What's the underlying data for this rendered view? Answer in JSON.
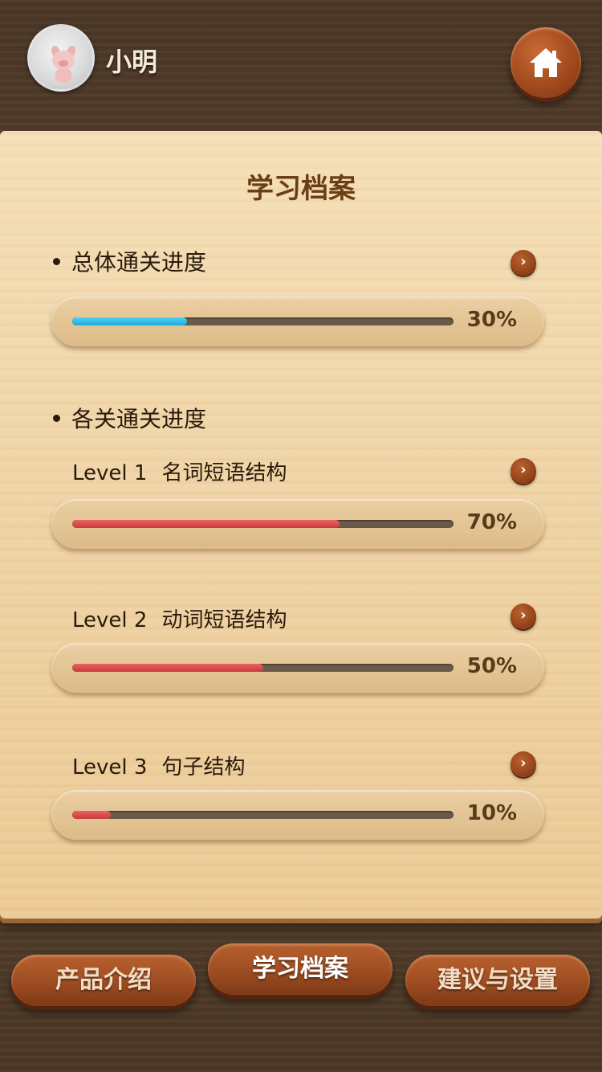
{
  "header": {
    "username": "小明",
    "avatar_icon": "pig-avatar-icon",
    "home_icon": "home-icon"
  },
  "board": {
    "title": "学习档案"
  },
  "overall": {
    "label": "总体通关进度",
    "progress": 0.3,
    "percent_text": "30%",
    "color": "#2bbbe6"
  },
  "levels_section": {
    "label": "各关通关进度"
  },
  "levels": [
    {
      "level": "Level 1",
      "name": "名词短语结构",
      "progress": 0.7,
      "percent_text": "70%",
      "color": "#d84a4a"
    },
    {
      "level": "Level 2",
      "name": "动词短语结构",
      "progress": 0.5,
      "percent_text": "50%",
      "color": "#d84a4a"
    },
    {
      "level": "Level 3",
      "name": "句子结构",
      "progress": 0.1,
      "percent_text": "10%",
      "color": "#d84a4a"
    }
  ],
  "tabs": [
    {
      "label": "产品介绍",
      "active": false
    },
    {
      "label": "学习档案",
      "active": true
    },
    {
      "label": "建议与设置",
      "active": false
    }
  ],
  "arrow_glyph": "›"
}
